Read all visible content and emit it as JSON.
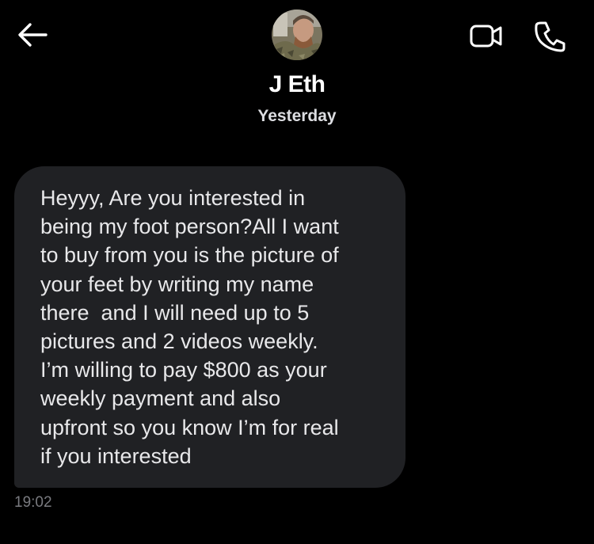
{
  "header": {
    "contact_name": "J Eth",
    "back_icon": "arrow-left-icon",
    "video_icon": "video-camera-icon",
    "phone_icon": "phone-icon"
  },
  "conversation": {
    "day_divider": "Yesterday",
    "messages": [
      {
        "text": "Heyyy, Are you interested in\nbeing my foot person?All I want\nto buy from you is the picture of\nyour feet by writing my name\nthere  and I will need up to 5\npictures and 2 videos weekly.\nI’m willing to pay $800 as your\nweekly payment and also\nupfront so you know I’m for real\nif you interested",
        "time": "19:02"
      }
    ]
  },
  "colors": {
    "background": "#000000",
    "bubble": "#202124",
    "text": "#ffffff",
    "timestamp": "#7a7b80"
  }
}
